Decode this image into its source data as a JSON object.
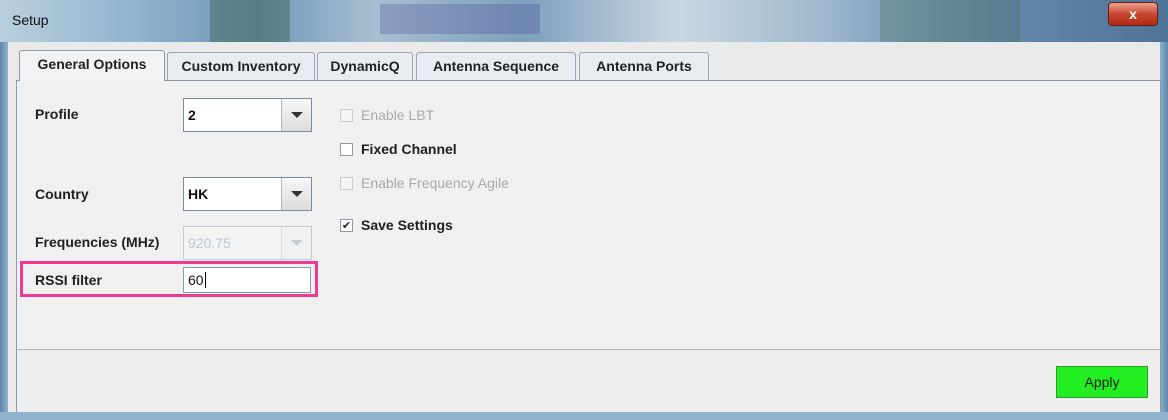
{
  "window": {
    "title": "Setup",
    "close_glyph": "x"
  },
  "tabs": [
    {
      "label": "General Options",
      "active": true
    },
    {
      "label": "Custom Inventory",
      "active": false
    },
    {
      "label": "DynamicQ",
      "active": false
    },
    {
      "label": "Antenna Sequence",
      "active": false
    },
    {
      "label": "Antenna Ports",
      "active": false
    }
  ],
  "form": {
    "profile": {
      "label": "Profile",
      "value": "2"
    },
    "country": {
      "label": "Country",
      "value": "HK"
    },
    "frequencies": {
      "label": "Frequencies (MHz)",
      "value": "920.75",
      "disabled": true
    },
    "rssi_filter": {
      "label": "RSSI filter",
      "value": "60",
      "highlight_color": "#ee3a93"
    }
  },
  "options": {
    "enable_lbt": {
      "label": "Enable LBT",
      "checked": false,
      "disabled": true
    },
    "fixed_channel": {
      "label": "Fixed Channel",
      "checked": false,
      "disabled": false
    },
    "enable_frequency_agile": {
      "label": "Enable Frequency Agile",
      "checked": false,
      "disabled": true
    },
    "save_settings": {
      "label": "Save Settings",
      "checked": true,
      "disabled": false
    }
  },
  "footer": {
    "apply_label": "Apply",
    "apply_color": "#22ee22"
  }
}
